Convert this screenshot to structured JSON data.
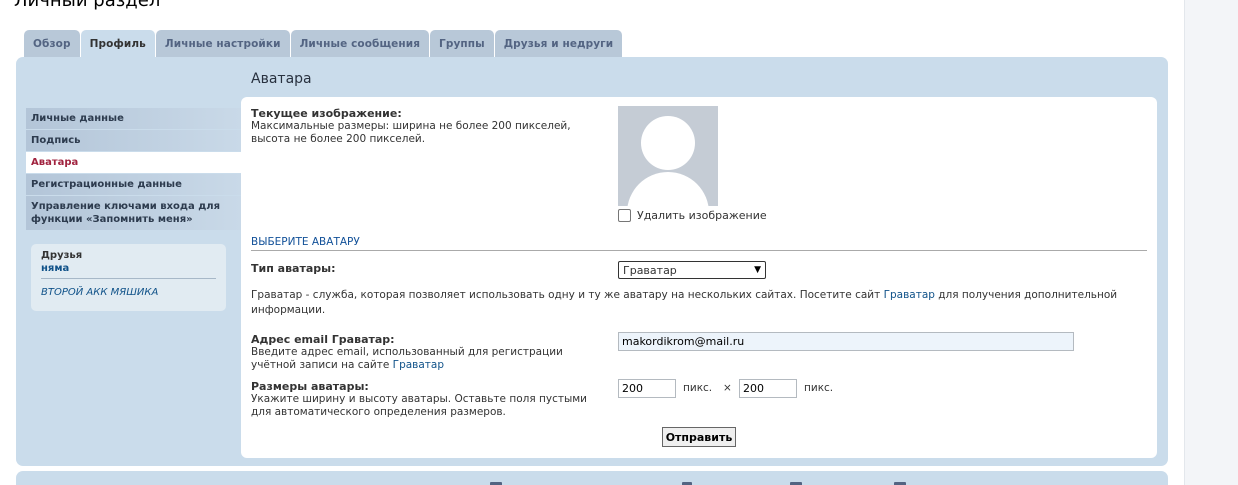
{
  "page_title": "Личный раздел",
  "tabs": [
    {
      "label": "Обзор",
      "active": false
    },
    {
      "label": "Профиль",
      "active": true
    },
    {
      "label": "Личные настройки",
      "active": false
    },
    {
      "label": "Личные сообщения",
      "active": false
    },
    {
      "label": "Группы",
      "active": false
    },
    {
      "label": "Друзья и недруги",
      "active": false
    }
  ],
  "side_menu": [
    {
      "label": "Личные данные",
      "active": false
    },
    {
      "label": "Подпись",
      "active": false
    },
    {
      "label": "Аватара",
      "active": true
    },
    {
      "label": "Регистрационные данные",
      "active": false
    },
    {
      "label": "Управление ключами входа для функции «Запомнить меня»",
      "active": false
    }
  ],
  "friends": {
    "title": "Друзья",
    "online": [
      "няма"
    ],
    "offline": [
      "ВТОРОЙ АКК МЯШИКА"
    ]
  },
  "content": {
    "title": "Аватара",
    "current_image": {
      "label": "Текущее изображение:",
      "desc_line1": "Максимальные размеры: ширина не более 200 пикселей,",
      "desc_line2": "высота не более 200 пикселей."
    },
    "delete_checkbox_label": "Удалить изображение",
    "delete_checked": false,
    "section_head": "ВЫБЕРИТЕ АВАТАРУ",
    "avatar_type": {
      "label": "Тип аватары:",
      "selected": "Граватар"
    },
    "gravatar_info": {
      "text_before": "Граватар - служба, которая позволяет использовать одну и ту же аватару на нескольких сайтах. Посетите сайт ",
      "link": "Граватар",
      "text_after": " для получения дополнительной",
      "line2": "информации."
    },
    "email": {
      "label": "Адрес email Граватар:",
      "desc_line1": "Введите адрес email, использованный для регистрации",
      "desc_line2_before": "учётной записи на сайте ",
      "desc_link": "Граватар",
      "value": "makordikrom@mail.ru"
    },
    "size": {
      "label": "Размеры аватары:",
      "desc_line1": "Укажите ширину и высоту аватары. Оставьте поля пустыми",
      "desc_line2": "для автоматического определения размеров.",
      "width": "200",
      "height": "200",
      "unit": "пикс.",
      "times": "×"
    },
    "submit_label": "Отправить"
  },
  "colors": {
    "panel": "#cadceb",
    "tab": "#b8c8d8",
    "link": "#105289",
    "active_menu_text": "#a1233f"
  }
}
